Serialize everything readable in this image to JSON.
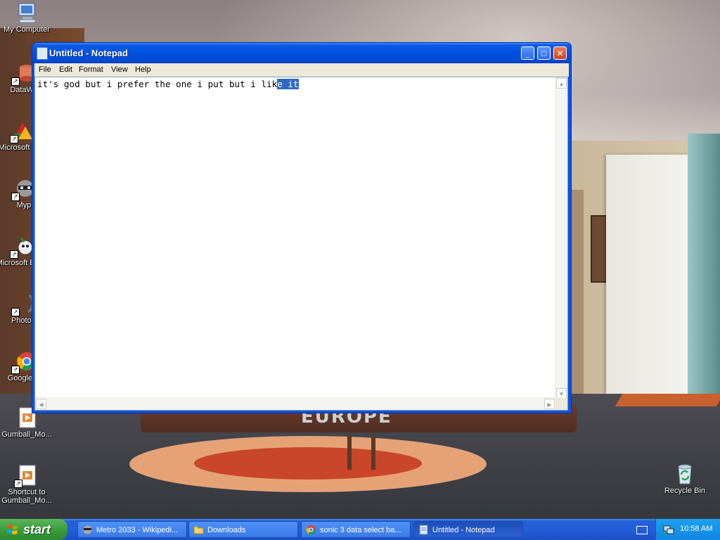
{
  "desktop": {
    "wallpaper_text": "EUROPE",
    "icons": [
      {
        "label": "My Computer"
      },
      {
        "label": "DataWa"
      },
      {
        "label": "Microsoft C++"
      },
      {
        "label": "Myp"
      },
      {
        "label": "Microsoft Basic"
      },
      {
        "label": "PhotoS"
      },
      {
        "label": "Google C"
      },
      {
        "label": "Gumball_Mo..."
      },
      {
        "label": "Shortcut to Gumball_Mo..."
      },
      {
        "label": "Recycle Bin"
      }
    ]
  },
  "notepad": {
    "title": "Untitled - Notepad",
    "menu": [
      "File",
      "Edit",
      "Format",
      "View",
      "Help"
    ],
    "content_before_selection": "it's god but i prefer the one i put but i lik",
    "content_selected": "e it",
    "buttons": {
      "minimize": "_",
      "maximize": "□",
      "close": "✕"
    }
  },
  "taskbar": {
    "start_label": "start",
    "items": [
      {
        "label": "Metro 2033 - Wikipedi...",
        "icon": "raccoon-icon",
        "active": false
      },
      {
        "label": "Downloads",
        "icon": "folder-icon",
        "active": false
      },
      {
        "label": "sonic 3 data select ba...",
        "icon": "chrome-icon",
        "active": false
      },
      {
        "label": "Untitled - Notepad",
        "icon": "notepad-icon",
        "active": true
      }
    ],
    "clock": "10:58 AM"
  },
  "colors": {
    "title_bar": "#0054e3",
    "taskbar": "#245edb",
    "start_button": "#3c9b3c",
    "selection": "#316ac5"
  }
}
